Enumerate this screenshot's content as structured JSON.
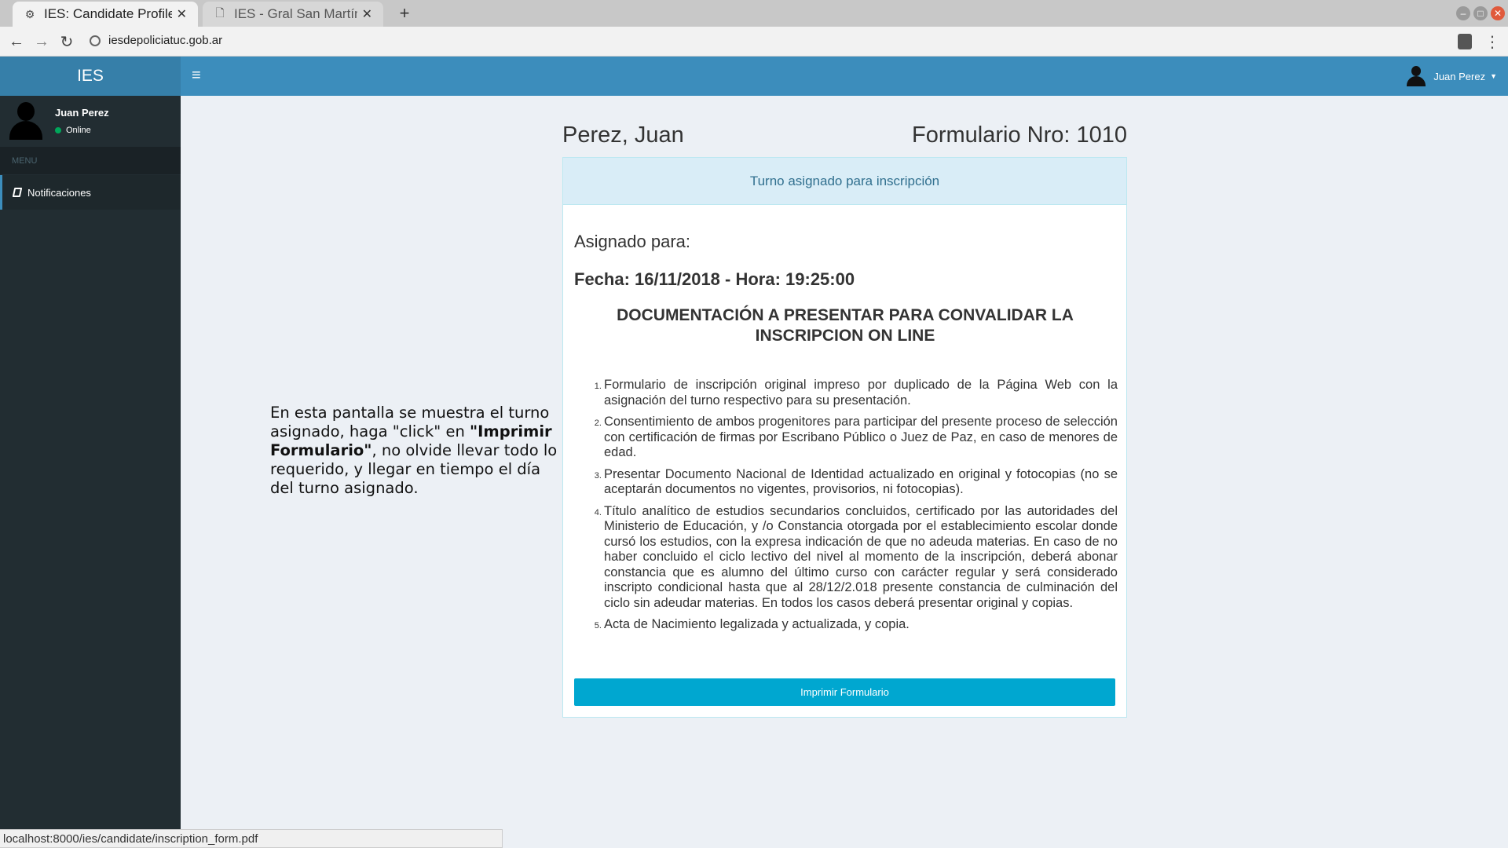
{
  "browser": {
    "tabs": [
      {
        "title": "IES: Candidate Profile",
        "active": true
      },
      {
        "title": "IES - Gral San Martín - Po",
        "active": false
      }
    ],
    "url": "iesdepoliciatuc.gob.ar",
    "status_url": "localhost:8000/ies/candidate/inscription_form.pdf",
    "icons": {
      "new_tab": "+",
      "close": "✕",
      "back": "←",
      "forward": "→",
      "reload": "↻",
      "menu": "⋮"
    }
  },
  "app": {
    "logo": "IES",
    "user_menu_name": "Juan Perez",
    "colors": {
      "header": "#3c8dbc",
      "logo_bg": "#367fa9",
      "sidebar": "#222d32",
      "button": "#00a7d0",
      "panel_heading": "#d9edf7"
    }
  },
  "sidebar": {
    "user_name": "Juan Perez",
    "status": "Online",
    "menu_header": "MENU",
    "items": [
      {
        "label": "Notificaciones",
        "icon": "book-icon"
      }
    ]
  },
  "content": {
    "candidate_name": "Perez, Juan",
    "form_number": "Formulario Nro: 1010",
    "panel_heading": "Turno asignado para inscripción",
    "assigned_label": "Asignado para:",
    "assigned_date": "Fecha: 16/11/2018 - Hora: 19:25:00",
    "doc_title": "DOCUMENTACIÓN A PRESENTAR PARA CONVALIDAR LA INSCRIPCION ON LINE",
    "requirements": [
      "Formulario de inscripción original impreso por duplicado de la Página Web con la asignación del turno respectivo para su presentación.",
      "Consentimiento de ambos progenitores para participar del presente proceso de selección con certificación de firmas por Escribano Público o Juez de Paz, en caso de menores de edad.",
      "Presentar Documento Nacional de Identidad actualizado en original y fotocopias (no se aceptarán documentos no vigentes, provisorios, ni fotocopias).",
      "Título analítico de estudios secundarios concluidos, certificado por las autoridades del Ministerio de Educación, y /o Constancia otorgada por el establecimiento escolar donde cursó los estudios, con la expresa indicación de que no adeuda materias. En caso de no haber concluido el ciclo lectivo del nivel al momento de la inscripción, deberá abonar constancia que es alumno del último curso con carácter regular y será considerado inscripto condicional hasta que al 28/12/2.018 presente constancia de culminación del ciclo sin adeudar materias. En todos los casos deberá presentar original y copias.",
      "Acta de Nacimiento legalizada y actualizada, y copia."
    ],
    "print_button": "Imprimir Formulario"
  },
  "annotation": {
    "text_before": "En esta pantalla se muestra el turno asignado, haga \"click\" en ",
    "bold": "\"Imprimir Formulario\"",
    "text_after": ", no olvide llevar todo lo requerido, y llegar en tiempo el día del turno asignado."
  }
}
